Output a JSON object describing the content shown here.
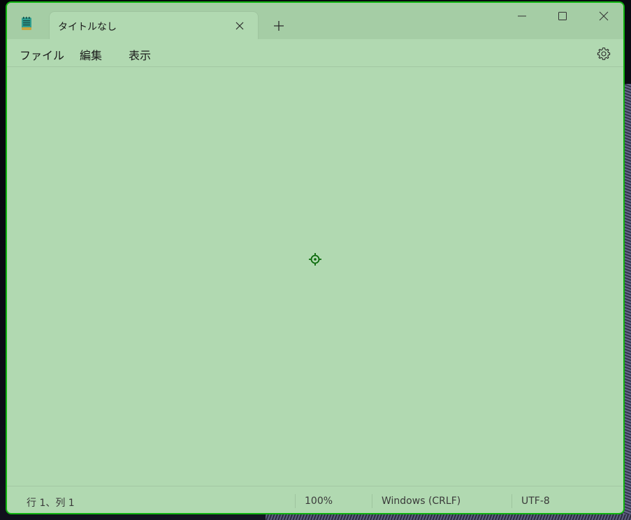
{
  "window": {
    "tab_title": "タイトルなし"
  },
  "icons": {
    "app": "notepad-icon",
    "tab_close": "close-icon",
    "new_tab": "plus-icon",
    "minimize": "minimize-icon",
    "maximize": "maximize-icon",
    "close": "close-icon",
    "settings": "gear-icon",
    "cursor": "crosshair-icon"
  },
  "menu": {
    "file": "ファイル",
    "edit": "編集",
    "view": "表示"
  },
  "status": {
    "position": "行 1、列 1",
    "zoom": "100%",
    "line_ending": "Windows (CRLF)",
    "encoding": "UTF-8"
  },
  "colors": {
    "window_bg": "#b1d9b1",
    "titlebar_bg": "#a5cda5",
    "border": "#0fb30f",
    "cursor": "#0a6a0a"
  }
}
